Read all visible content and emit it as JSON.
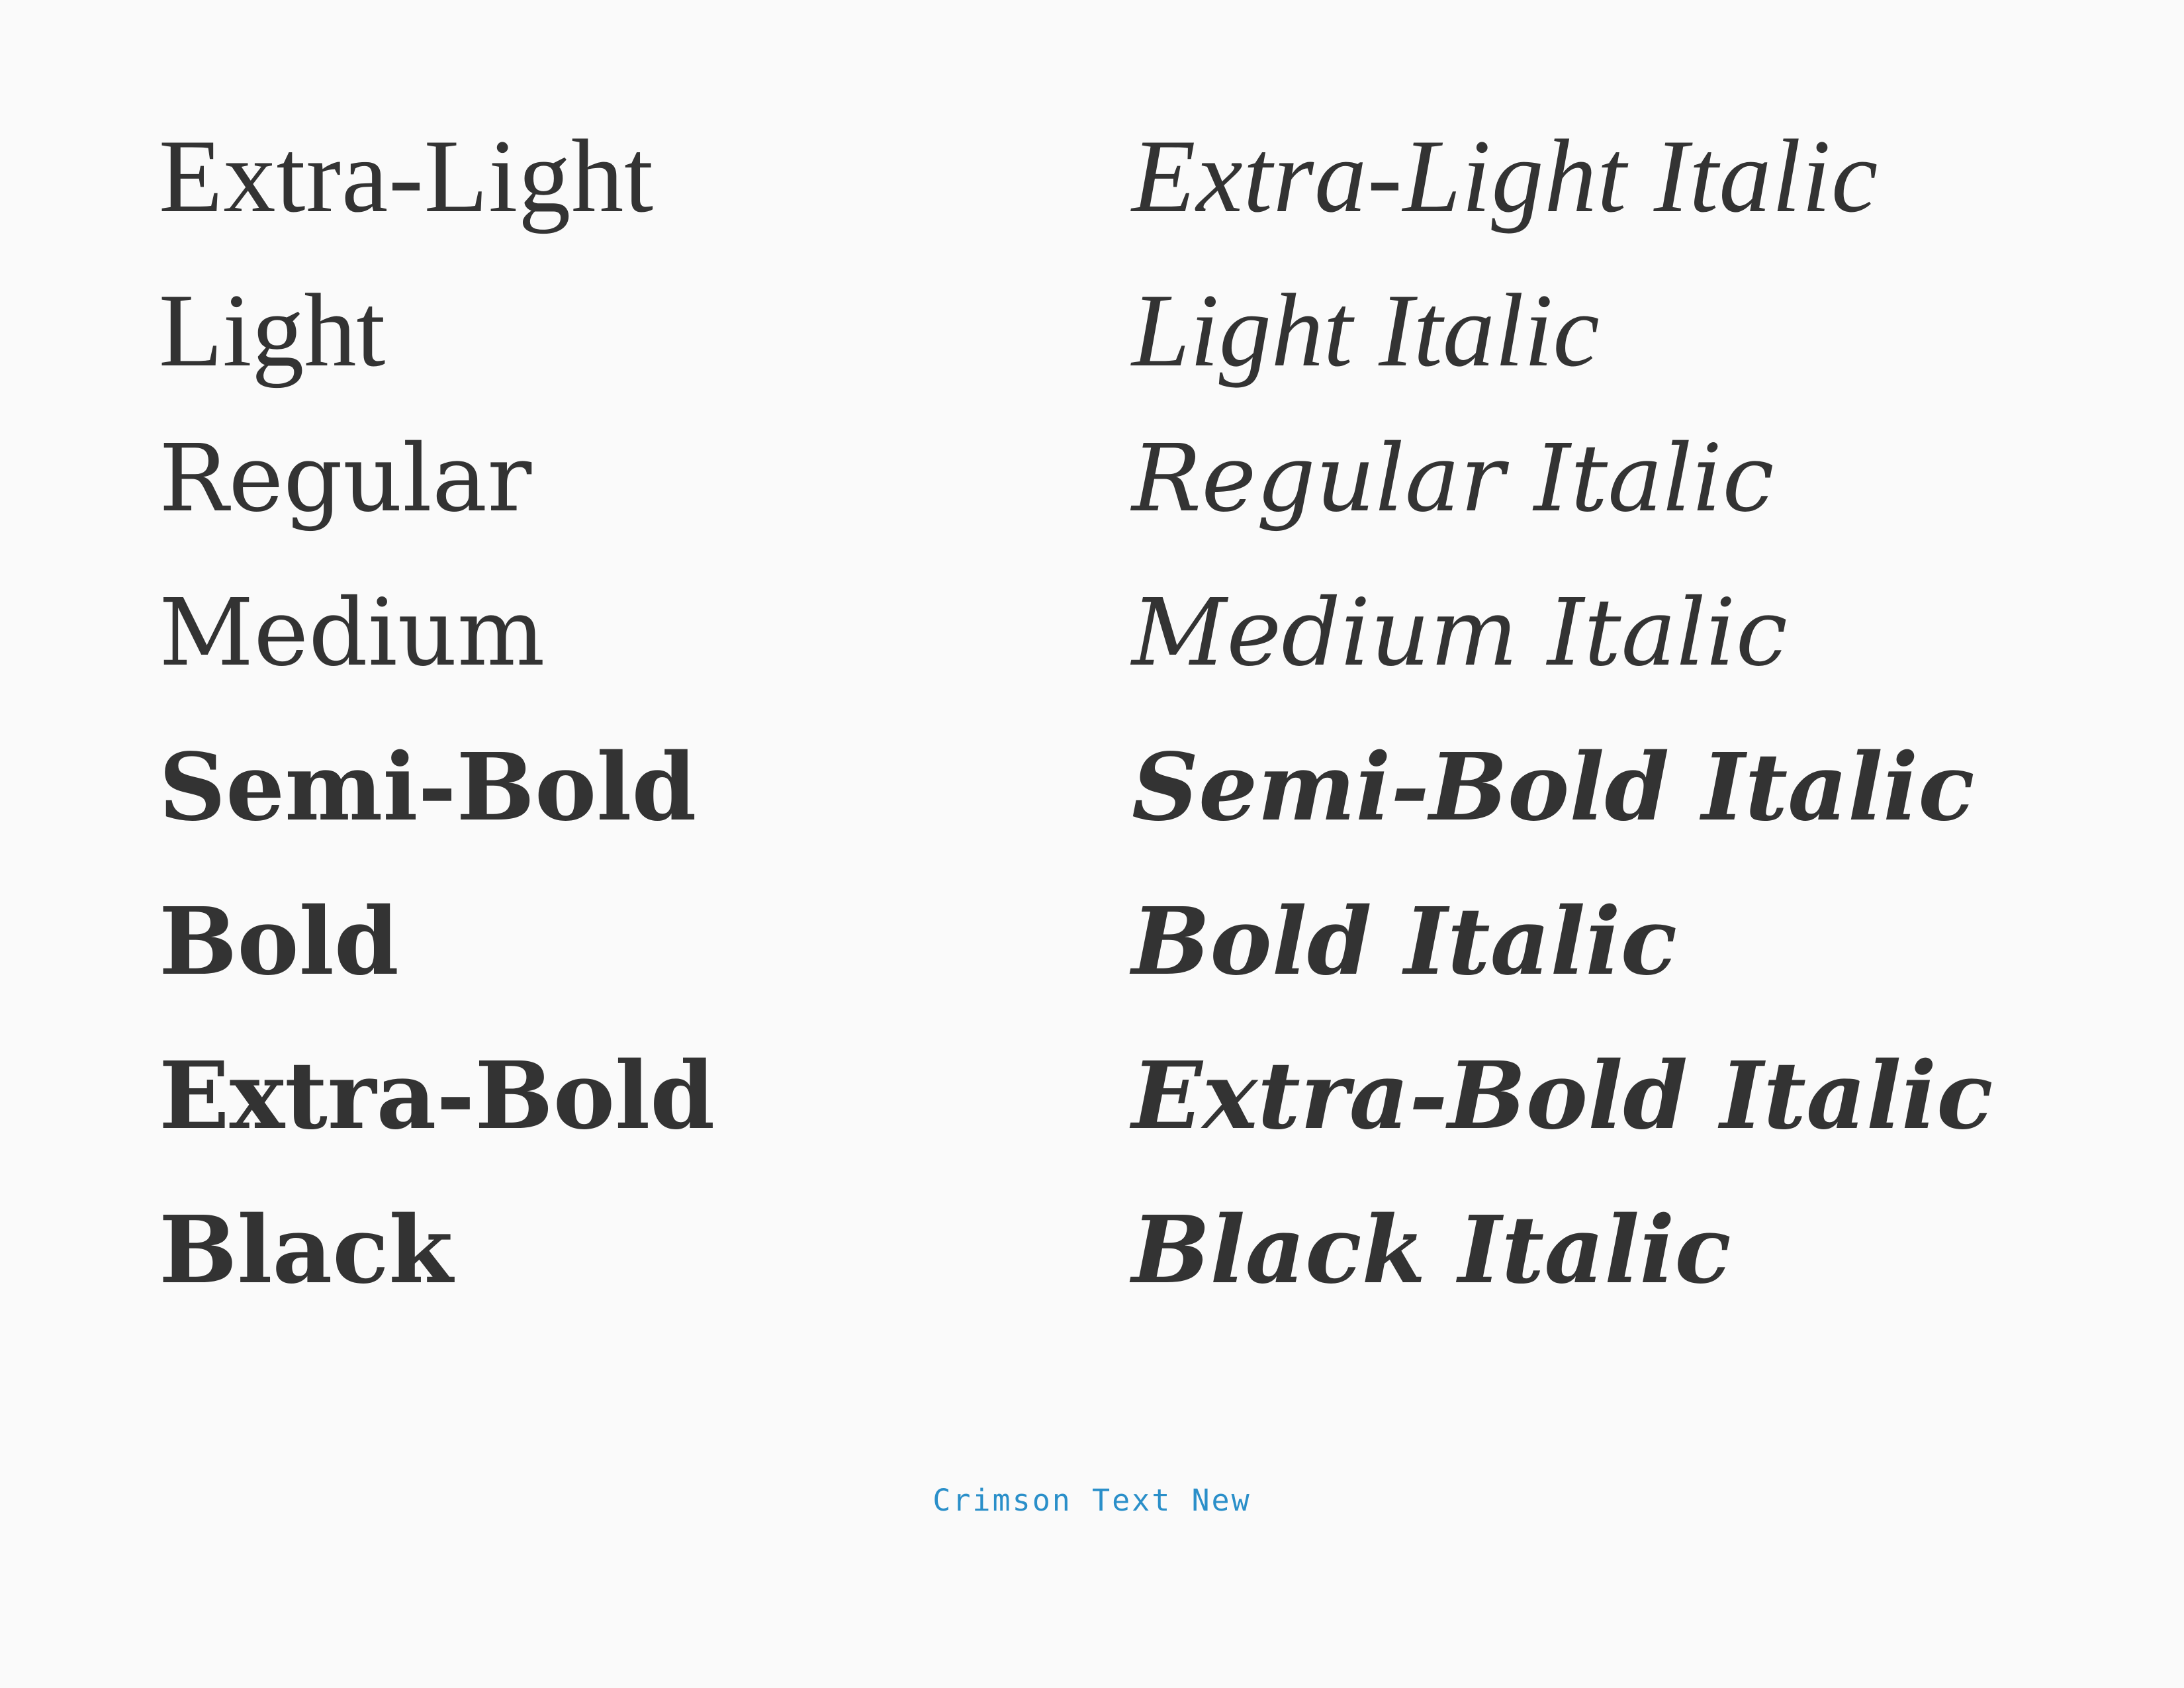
{
  "specimen": {
    "roman": [
      "Extra-Light",
      "Light",
      "Regular",
      "Medium",
      "Semi-Bold",
      "Bold",
      "Extra-Bold",
      "Black"
    ],
    "italic": [
      "Extra-Light Italic",
      "Light Italic",
      "Regular Italic",
      "Medium Italic",
      "Semi-Bold Italic",
      "Bold Italic",
      "Extra-Bold Italic",
      "Black Italic"
    ],
    "caption": "Crimson Text New"
  },
  "colors": {
    "background": "#fafafa",
    "text": "#333333",
    "caption": "#2a8fc9"
  }
}
